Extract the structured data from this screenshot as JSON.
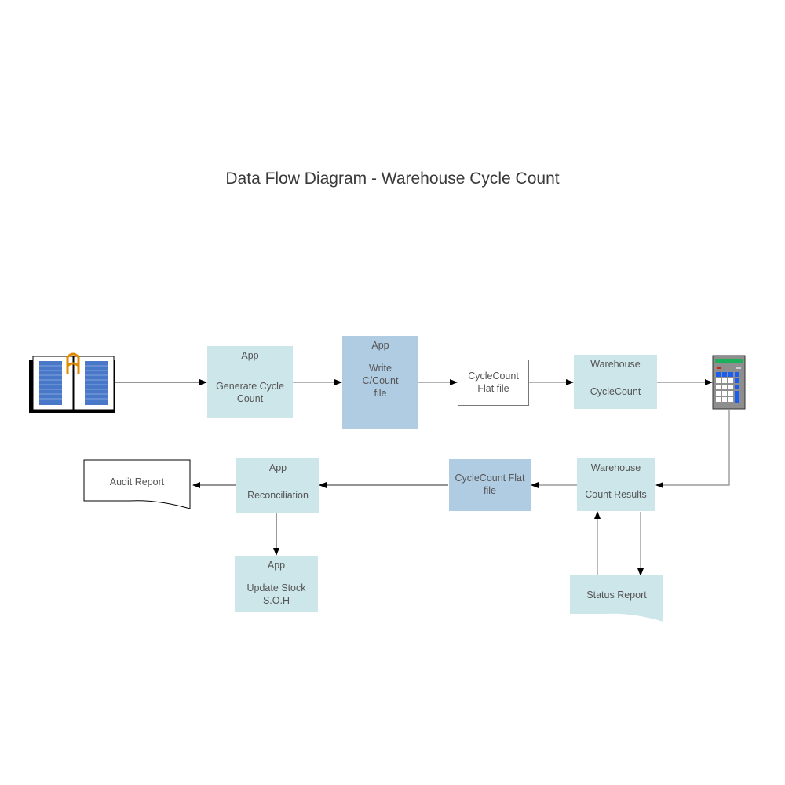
{
  "title": "Data Flow Diagram - Warehouse Cycle Count",
  "colors": {
    "process_fill": "#cde6ea",
    "file_fill": "#b0cce2",
    "connector": "#666666",
    "arrowhead": "#000000",
    "text": "#555555"
  },
  "nodes": {
    "generate": {
      "header": "App",
      "label": "Generate Cycle Count"
    },
    "write": {
      "header": "App",
      "label": "Write C/Count file"
    },
    "flatfile1": {
      "label": "CycleCount Flat file"
    },
    "wh_cyclecount": {
      "header": "Warehouse",
      "label": "CycleCount"
    },
    "wh_results": {
      "header": "Warehouse",
      "label": "Count Results"
    },
    "flatfile2": {
      "label": "CycleCount Flat file"
    },
    "reconciliation": {
      "header": "App",
      "label": "Reconciliation"
    },
    "audit_report": {
      "label": "Audit Report"
    },
    "update_stock": {
      "header": "App",
      "label": "Update Stock S.O.H"
    },
    "status_report": {
      "label": "Status Report"
    }
  },
  "icons": {
    "source": "book-icon",
    "device": "calculator-icon"
  },
  "edges": [
    {
      "from": "book",
      "to": "generate"
    },
    {
      "from": "generate",
      "to": "write"
    },
    {
      "from": "write",
      "to": "flatfile1"
    },
    {
      "from": "flatfile1",
      "to": "wh_cyclecount"
    },
    {
      "from": "wh_cyclecount",
      "to": "calculator"
    },
    {
      "from": "calculator",
      "to": "wh_results"
    },
    {
      "from": "wh_results",
      "to": "flatfile2"
    },
    {
      "from": "flatfile2",
      "to": "reconciliation"
    },
    {
      "from": "reconciliation",
      "to": "audit_report"
    },
    {
      "from": "reconciliation",
      "to": "update_stock"
    },
    {
      "from": "wh_results",
      "to": "status_report"
    },
    {
      "from": "status_report",
      "to": "wh_results"
    }
  ]
}
